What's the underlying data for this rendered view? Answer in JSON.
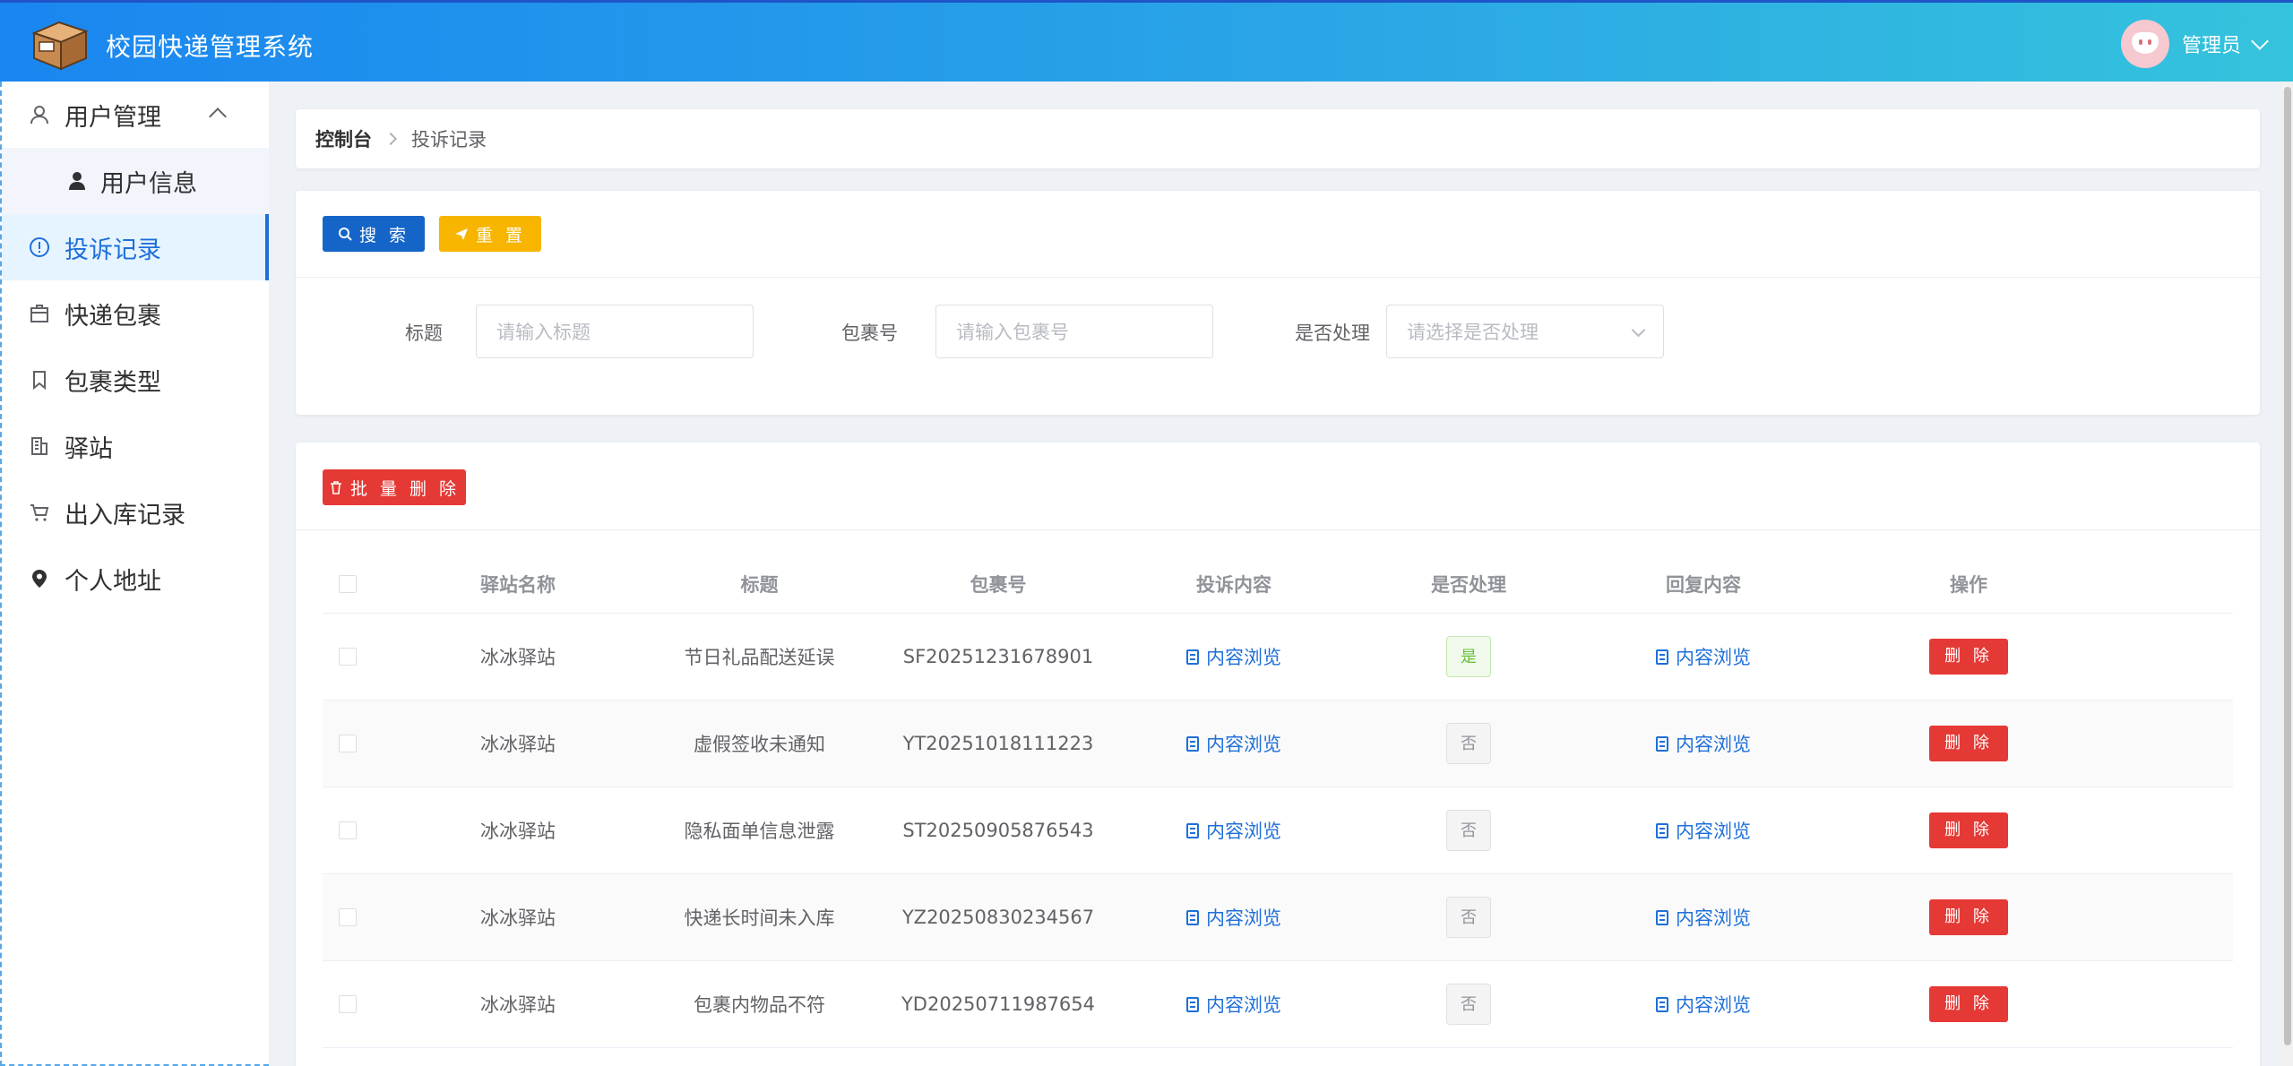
{
  "header": {
    "app_title": "校园快递管理系统",
    "user_name": "管理员"
  },
  "sidebar": {
    "items": [
      {
        "label": "用户管理",
        "icon": "user-outline-icon"
      },
      {
        "label": "用户信息",
        "icon": "user-solid-icon"
      },
      {
        "label": "投诉记录",
        "icon": "info-circle-icon"
      },
      {
        "label": "快递包裹",
        "icon": "package-icon"
      },
      {
        "label": "包裹类型",
        "icon": "bookmark-icon"
      },
      {
        "label": "驿站",
        "icon": "office-building-icon"
      },
      {
        "label": "出入库记录",
        "icon": "shopping-cart-icon"
      },
      {
        "label": "个人地址",
        "icon": "location-pin-icon"
      }
    ],
    "active_index": 2
  },
  "breadcrumb": {
    "home": "控制台",
    "current": "投诉记录"
  },
  "search": {
    "search_label": "搜 索",
    "reset_label": "重 置",
    "title_label": "标题",
    "title_placeholder": "请输入标题",
    "package_label": "包裹号",
    "package_placeholder": "请输入包裹号",
    "handled_label": "是否处理",
    "handled_placeholder": "请选择是否处理"
  },
  "table": {
    "batch_delete_label": "批 量 删 除",
    "columns": [
      "驿站名称",
      "标题",
      "包裹号",
      "投诉内容",
      "是否处理",
      "回复内容",
      "操作"
    ],
    "view_label": "内容浏览",
    "delete_label": "删 除",
    "rows": [
      {
        "station": "冰冰驿站",
        "title": "节日礼品配送延误",
        "package_no": "SF20251231678901",
        "handled": "是"
      },
      {
        "station": "冰冰驿站",
        "title": "虚假签收未通知",
        "package_no": "YT20251018111223",
        "handled": "否"
      },
      {
        "station": "冰冰驿站",
        "title": "隐私面单信息泄露",
        "package_no": "ST20250905876543",
        "handled": "否"
      },
      {
        "station": "冰冰驿站",
        "title": "快递长时间未入库",
        "package_no": "YZ20250830234567",
        "handled": "否"
      },
      {
        "station": "冰冰驿站",
        "title": "包裹内物品不符",
        "package_no": "YD20250711987654",
        "handled": "否"
      }
    ]
  },
  "colors": {
    "header_start": "#1a86f0",
    "header_end": "#34c3dc",
    "primary": "#1565c8",
    "warning": "#f7b500",
    "danger": "#e53935",
    "active_text": "#1e6fd9"
  }
}
